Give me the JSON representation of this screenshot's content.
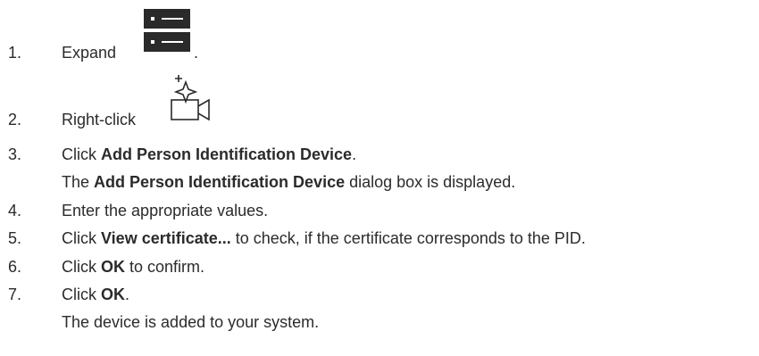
{
  "steps": [
    {
      "num": "1.",
      "text": "Expand",
      "suffix": "."
    },
    {
      "num": "2.",
      "text": "Right-click"
    },
    {
      "num": "3.",
      "pre": "Click ",
      "bold": "Add Person Identification Device",
      "post": "."
    },
    {
      "num": "4.",
      "text": "Enter the appropriate values."
    },
    {
      "num": "5.",
      "pre": "Click ",
      "bold": "View certificate...",
      "post": " to check, if the certificate corresponds to the PID."
    },
    {
      "num": "6.",
      "pre": "Click ",
      "bold": "OK",
      "post": " to confirm."
    },
    {
      "num": "7.",
      "pre": "Click ",
      "bold": "OK",
      "post": "."
    }
  ],
  "notes": {
    "dialog": {
      "pre": "The ",
      "bold": "Add Person Identification Device",
      "post": " dialog box is displayed."
    },
    "added": "The device is added to your system."
  },
  "icons": {
    "step1": "device-list-icon",
    "step2": "pid-camera-icon"
  }
}
